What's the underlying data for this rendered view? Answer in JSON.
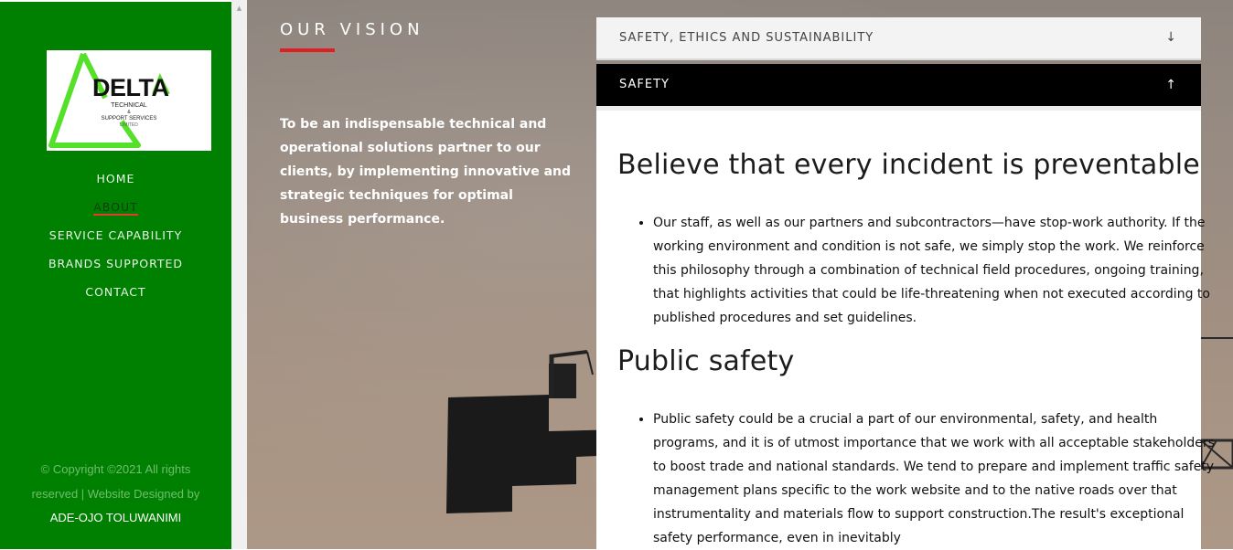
{
  "brand": {
    "logo_word": "DELTA",
    "logo_sub1": "TECHNICAL",
    "logo_sub2": "&",
    "logo_sub3": "SUPPORT SERVICES",
    "logo_sub4": "LIMITED",
    "accent_color": "#008000"
  },
  "nav": {
    "items": [
      {
        "label": "HOME"
      },
      {
        "label": "ABOUT"
      },
      {
        "label": "SERVICE CAPABILITY"
      },
      {
        "label": "BRANDS SUPPORTED"
      },
      {
        "label": "CONTACT"
      }
    ],
    "active": "ABOUT"
  },
  "footer": {
    "copyright": "© Copyright ©2021 All rights reserved | Website Designed by",
    "author": "ADE-OJO TOLUWANIMI"
  },
  "vision": {
    "title": "OUR VISION",
    "text": "To be an indispensable technical and operational solutions partner to our clients, by implementing innovative and strategic techniques for optimal business performance."
  },
  "accordion": {
    "section1": {
      "label": "SAFETY, ETHICS AND SUSTAINABILITY",
      "icon": "arrow-down-icon"
    },
    "section2": {
      "label": "SAFETY",
      "icon": "arrow-up-icon"
    },
    "heading1": "Believe that every incident is preventable",
    "bullet1": "Our staff, as well as our partners and subcontractors—have stop-work authority. If the working environment and condition is not safe, we simply stop the work. We reinforce this philosophy through a combination of technical field procedures, ongoing training, that highlights activities that could be life-threatening when not executed according to published procedures and set guidelines.",
    "heading2": "Public safety",
    "bullet2": "Public safety could be a crucial a part of our environmental, safety, and health programs, and it is of utmost importance that we work with all acceptable stakeholders to boost trade and national standards. We tend to prepare and implement traffic safety management plans specific to the work website and to the native roads over that instrumentality and materials flow to support construction.The result's exceptional safety performance, even in inevitably"
  }
}
